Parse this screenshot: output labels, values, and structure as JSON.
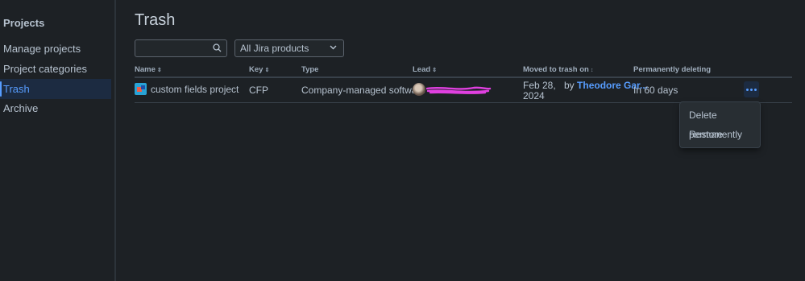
{
  "sidebar": {
    "title": "Projects",
    "items": [
      {
        "label": "Manage projects"
      },
      {
        "label": "Project categories"
      },
      {
        "label": "Trash"
      },
      {
        "label": "Archive"
      }
    ]
  },
  "page": {
    "title": "Trash"
  },
  "filters": {
    "search_placeholder": "",
    "product_select": "All Jira products"
  },
  "table": {
    "headers": {
      "name": "Name",
      "key": "Key",
      "type": "Type",
      "lead": "Lead",
      "moved": "Moved to trash on",
      "deleting": "Permanently deleting"
    },
    "rows": [
      {
        "name": "custom fields project",
        "key": "CFP",
        "type": "Company-managed software",
        "moved_line1": "Feb 28,",
        "moved_line2": "2024",
        "by_prefix": "by",
        "by_user": "Theodore Gar...",
        "deleting": "In 60 days"
      }
    ]
  },
  "menu": {
    "items": [
      {
        "label": "Delete permanently"
      },
      {
        "label": "Restore"
      }
    ]
  },
  "colors": {
    "background": "#1d2125",
    "accent": "#579dff",
    "active_bg": "#1c2b41",
    "redaction": "#e040e0"
  },
  "icons": [
    "search-icon",
    "chevron-down-icon",
    "sort-icon",
    "project-icon",
    "avatar",
    "more-icon"
  ]
}
